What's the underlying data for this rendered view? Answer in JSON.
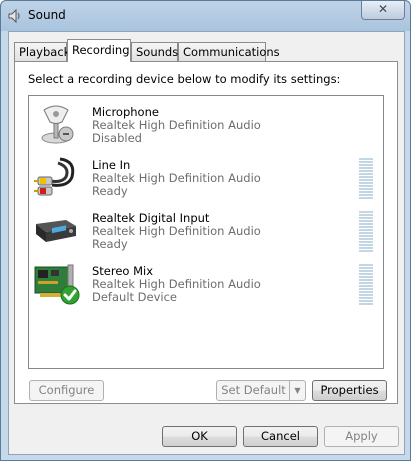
{
  "window": {
    "title": "Sound",
    "close_label": "✕",
    "app_icon": "speaker-icon"
  },
  "tabs": [
    {
      "label": "Playback",
      "active": false
    },
    {
      "label": "Recording",
      "active": true
    },
    {
      "label": "Sounds",
      "active": false
    },
    {
      "label": "Communications",
      "active": false
    }
  ],
  "panel": {
    "instruction": "Select a recording device below to modify its settings:"
  },
  "devices": [
    {
      "name": "Microphone",
      "driver": "Realtek High Definition Audio",
      "status": "Disabled",
      "icon": "microphone-icon",
      "has_meter": false
    },
    {
      "name": "Line In",
      "driver": "Realtek High Definition Audio",
      "status": "Ready",
      "icon": "rca-cable-icon",
      "has_meter": true
    },
    {
      "name": "Realtek Digital Input",
      "driver": "Realtek High Definition Audio",
      "status": "Ready",
      "icon": "digital-input-device-icon",
      "has_meter": true
    },
    {
      "name": "Stereo Mix",
      "driver": "Realtek High Definition Audio",
      "status": "Default Device",
      "icon": "sound-card-default-icon",
      "has_meter": true
    }
  ],
  "buttons": {
    "configure": "Configure",
    "set_default": "Set Default",
    "set_default_arrow": "▼",
    "properties": "Properties",
    "ok": "OK",
    "cancel": "Cancel",
    "apply": "Apply"
  },
  "colors": {
    "default_check": "#2fa32f",
    "meter": "#c3d6e4"
  }
}
